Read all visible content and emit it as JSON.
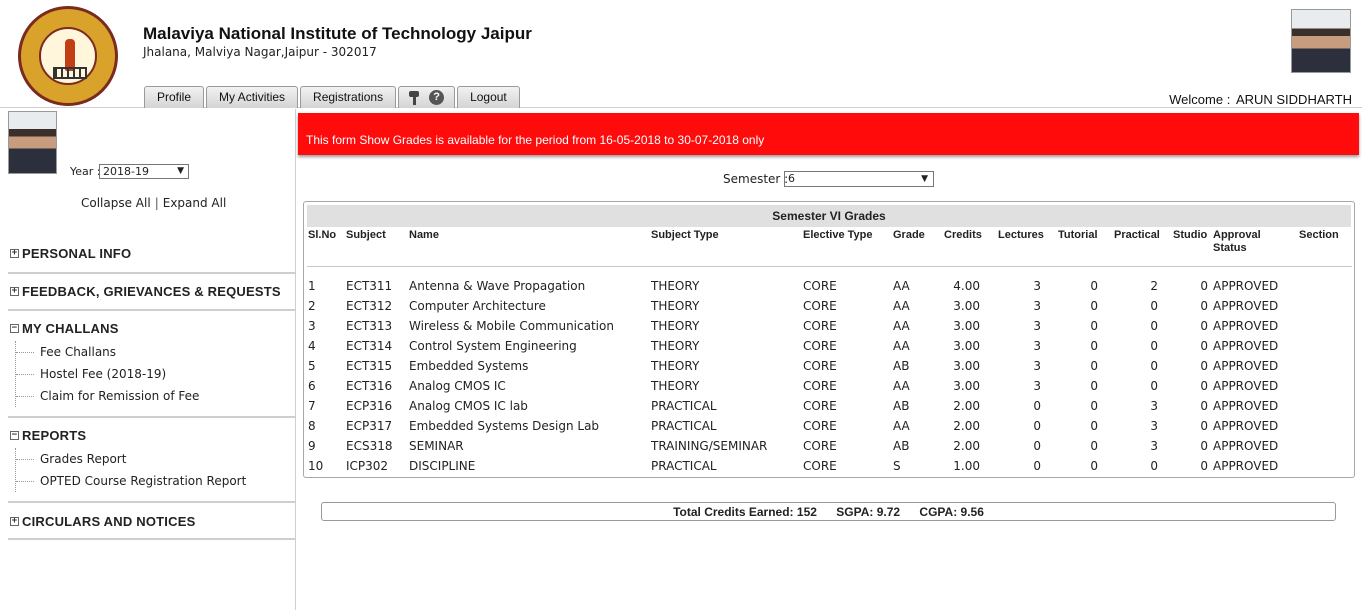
{
  "header": {
    "institute_name": "Malaviya National Institute of Technology Jaipur",
    "address": "Jhalana, Malviya Nagar,Jaipur - 302017",
    "welcome_label": "Welcome :",
    "user_name": "ARUN SIDDHARTH",
    "tabs": [
      "Profile",
      "My Activities",
      "Registrations",
      "Logout"
    ]
  },
  "sidebar": {
    "year_label": "Year :",
    "year_value": "2018-19",
    "collapse_all": "Collapse All",
    "separator": "|",
    "expand_all": "Expand All",
    "sections": [
      {
        "title": "PERSONAL INFO",
        "items": []
      },
      {
        "title": "FEEDBACK, GRIEVANCES & REQUESTS",
        "items": []
      },
      {
        "title": "MY CHALLANS",
        "items": [
          "Fee Challans",
          "Hostel Fee (2018-19)",
          "Claim for Remission of Fee"
        ]
      },
      {
        "title": "REPORTS",
        "items": [
          "Grades Report",
          "OPTED Course Registration Report"
        ]
      },
      {
        "title": "CIRCULARS AND NOTICES",
        "items": []
      }
    ]
  },
  "alert": {
    "message": "This form Show Grades is available for the period from 16-05-2018 to 30-07-2018 only",
    "color": "#ff0b0b"
  },
  "semester": {
    "label": "Semester :",
    "value": "6"
  },
  "grades": {
    "title": "Semester VI Grades",
    "columns": [
      "Sl.No",
      "Subject",
      "Name",
      "Subject Type",
      "Elective Type",
      "Grade",
      "Credits",
      "Lectures",
      "Tutorial",
      "Practical",
      "Studio",
      "Approval Status",
      "Section"
    ],
    "rows": [
      [
        "1",
        "ECT311",
        "Antenna & Wave Propagation",
        "THEORY",
        "CORE",
        "AA",
        "4.00",
        "3",
        "0",
        "2",
        "0",
        "APPROVED"
      ],
      [
        "2",
        "ECT312",
        "Computer Architecture",
        "THEORY",
        "CORE",
        "AA",
        "3.00",
        "3",
        "0",
        "0",
        "0",
        "APPROVED"
      ],
      [
        "3",
        "ECT313",
        "Wireless & Mobile Communication",
        "THEORY",
        "CORE",
        "AA",
        "3.00",
        "3",
        "0",
        "0",
        "0",
        "APPROVED"
      ],
      [
        "4",
        "ECT314",
        "Control System Engineering",
        "THEORY",
        "CORE",
        "AA",
        "3.00",
        "3",
        "0",
        "0",
        "0",
        "APPROVED"
      ],
      [
        "5",
        "ECT315",
        "Embedded Systems",
        "THEORY",
        "CORE",
        "AB",
        "3.00",
        "3",
        "0",
        "0",
        "0",
        "APPROVED"
      ],
      [
        "6",
        "ECT316",
        "Analog CMOS IC",
        "THEORY",
        "CORE",
        "AA",
        "3.00",
        "3",
        "0",
        "0",
        "0",
        "APPROVED"
      ],
      [
        "7",
        "ECP316",
        "Analog CMOS IC lab",
        "PRACTICAL",
        "CORE",
        "AB",
        "2.00",
        "0",
        "0",
        "3",
        "0",
        "APPROVED"
      ],
      [
        "8",
        "ECP317",
        "Embedded Systems Design Lab",
        "PRACTICAL",
        "CORE",
        "AA",
        "2.00",
        "0",
        "0",
        "3",
        "0",
        "APPROVED"
      ],
      [
        "9",
        "ECS318",
        "SEMINAR",
        "TRAINING/SEMINAR",
        "CORE",
        "AB",
        "2.00",
        "0",
        "0",
        "3",
        "0",
        "APPROVED"
      ],
      [
        "10",
        "ICP302",
        "DISCIPLINE",
        "PRACTICAL",
        "CORE",
        "S",
        "1.00",
        "0",
        "0",
        "0",
        "0",
        "APPROVED"
      ]
    ]
  },
  "totals": {
    "credits": "Total Credits Earned: 152",
    "sgpa": "SGPA: 9.72",
    "cgpa": "CGPA: 9.56"
  }
}
